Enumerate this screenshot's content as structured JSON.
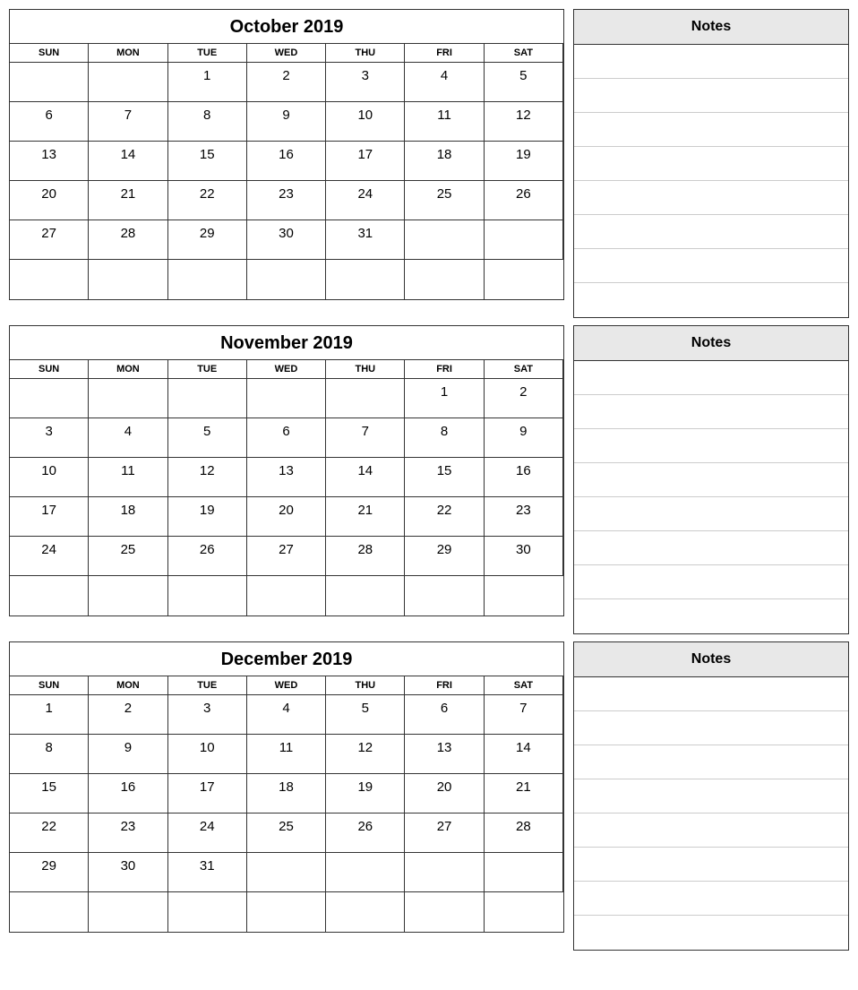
{
  "months": [
    {
      "title": "October 2019",
      "days_header": [
        "SUN",
        "MON",
        "TUE",
        "WED",
        "THU",
        "FRI",
        "SAT"
      ],
      "weeks": [
        [
          "",
          "",
          "1",
          "2",
          "3",
          "4",
          "5"
        ],
        [
          "6",
          "7",
          "8",
          "9",
          "10",
          "11",
          "12"
        ],
        [
          "13",
          "14",
          "15",
          "16",
          "17",
          "18",
          "19"
        ],
        [
          "20",
          "21",
          "22",
          "23",
          "24",
          "25",
          "26"
        ],
        [
          "27",
          "28",
          "29",
          "30",
          "31",
          "",
          ""
        ],
        [
          "",
          "",
          "",
          "",
          "",
          "",
          ""
        ]
      ],
      "notes_title": "Notes",
      "notes_lines": 8
    },
    {
      "title": "November 2019",
      "days_header": [
        "SUN",
        "MON",
        "TUE",
        "WED",
        "THU",
        "FRI",
        "SAT"
      ],
      "weeks": [
        [
          "",
          "",
          "",
          "",
          "",
          "1",
          "2"
        ],
        [
          "3",
          "4",
          "5",
          "6",
          "7",
          "8",
          "9"
        ],
        [
          "10",
          "11",
          "12",
          "13",
          "14",
          "15",
          "16"
        ],
        [
          "17",
          "18",
          "19",
          "20",
          "21",
          "22",
          "23"
        ],
        [
          "24",
          "25",
          "26",
          "27",
          "28",
          "29",
          "30"
        ],
        [
          "",
          "",
          "",
          "",
          "",
          "",
          ""
        ]
      ],
      "notes_title": "Notes",
      "notes_lines": 8
    },
    {
      "title": "December 2019",
      "days_header": [
        "SUN",
        "MON",
        "TUE",
        "WED",
        "THU",
        "FRI",
        "SAT"
      ],
      "weeks": [
        [
          "1",
          "2",
          "3",
          "4",
          "5",
          "6",
          "7"
        ],
        [
          "8",
          "9",
          "10",
          "11",
          "12",
          "13",
          "14"
        ],
        [
          "15",
          "16",
          "17",
          "18",
          "19",
          "20",
          "21"
        ],
        [
          "22",
          "23",
          "24",
          "25",
          "26",
          "27",
          "28"
        ],
        [
          "29",
          "30",
          "31",
          "",
          "",
          "",
          ""
        ],
        [
          "",
          "",
          "",
          "",
          "",
          "",
          ""
        ]
      ],
      "notes_title": "Notes",
      "notes_lines": 8
    }
  ]
}
